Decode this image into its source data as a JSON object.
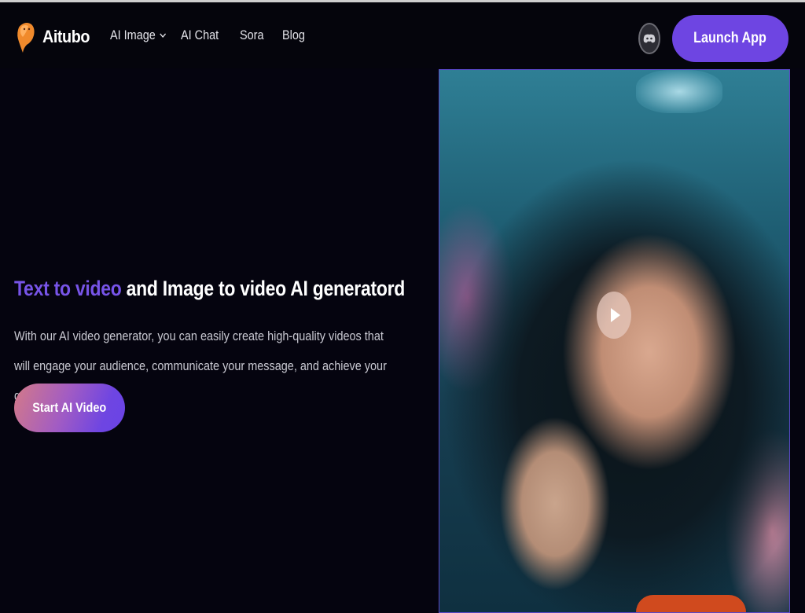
{
  "brand": {
    "name": "Aitubo",
    "logo_icon": "otter-mascot-icon"
  },
  "nav": {
    "items": [
      {
        "label": "AI Image",
        "has_dropdown": true
      },
      {
        "label": "AI Chat"
      },
      {
        "label": "Sora"
      },
      {
        "label": "Blog"
      }
    ]
  },
  "header": {
    "discord_icon": "discord-icon",
    "launch_label": "Launch App"
  },
  "hero": {
    "title_accent": "Text to video",
    "title_rest": " and Image to video AI generatord",
    "description": "With our AI video generator, you can easily create high-quality videos that will engage your audience, communicate your message, and achieve your goals.",
    "cta_label": "Start AI Video"
  },
  "video": {
    "play_icon": "play-icon"
  },
  "colors": {
    "accent": "#6e45e2",
    "title_accent": "#7754e8",
    "background": "#05040f",
    "cta_gradient_start": "#d47a88",
    "cta_gradient_end": "#6a44e6"
  }
}
